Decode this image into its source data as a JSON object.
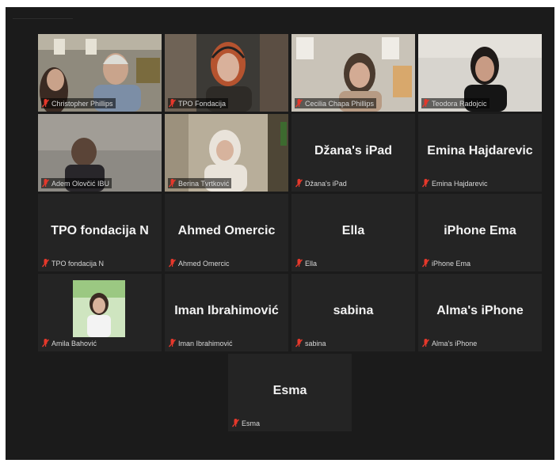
{
  "meeting": {
    "participants": [
      {
        "name": "Christopher Phillips",
        "display": "",
        "video": true,
        "active": false
      },
      {
        "name": "TPO Fondacija",
        "display": "",
        "video": true,
        "active": false
      },
      {
        "name": "Cecilia Chapa Phillips",
        "display": "",
        "video": true,
        "active": false
      },
      {
        "name": "Teodora Radojcic",
        "display": "",
        "video": true,
        "active": false
      },
      {
        "name": "Adem Olovčić IBU",
        "display": "",
        "video": true,
        "active": false
      },
      {
        "name": "Berina Tvrtković",
        "display": "",
        "video": true,
        "active": true
      },
      {
        "name": "Džana's iPad",
        "display": "Džana's iPad",
        "video": false,
        "active": false
      },
      {
        "name": "Emina Hajdarevic",
        "display": "Emina Hajdarevic",
        "video": false,
        "active": false
      },
      {
        "name": "TPO fondacija N",
        "display": "TPO fondacija N",
        "video": false,
        "active": false
      },
      {
        "name": "Ahmed Omercic",
        "display": "Ahmed Omercic",
        "video": false,
        "active": false
      },
      {
        "name": "Ella",
        "display": "Ella",
        "video": false,
        "active": false
      },
      {
        "name": "iPhone Ema",
        "display": "iPhone Ema",
        "video": false,
        "active": false
      },
      {
        "name": "Amila Bahović",
        "display": "",
        "video": false,
        "avatar": true,
        "active": false
      },
      {
        "name": "Iman Ibrahimović",
        "display": "Iman Ibrahimović",
        "video": false,
        "active": false
      },
      {
        "name": "sabina",
        "display": "sabina",
        "video": false,
        "active": false
      },
      {
        "name": "Alma's iPhone",
        "display": "Alma's iPhone",
        "video": false,
        "active": false
      },
      {
        "name": "Esma",
        "display": "Esma",
        "video": false,
        "active": false
      }
    ],
    "muted_icon": "muted-mic-icon",
    "colors": {
      "background": "#1b1b1b",
      "tile": "#242424",
      "active_border": "#b8d34a",
      "muted_icon": "#e5382b"
    }
  }
}
